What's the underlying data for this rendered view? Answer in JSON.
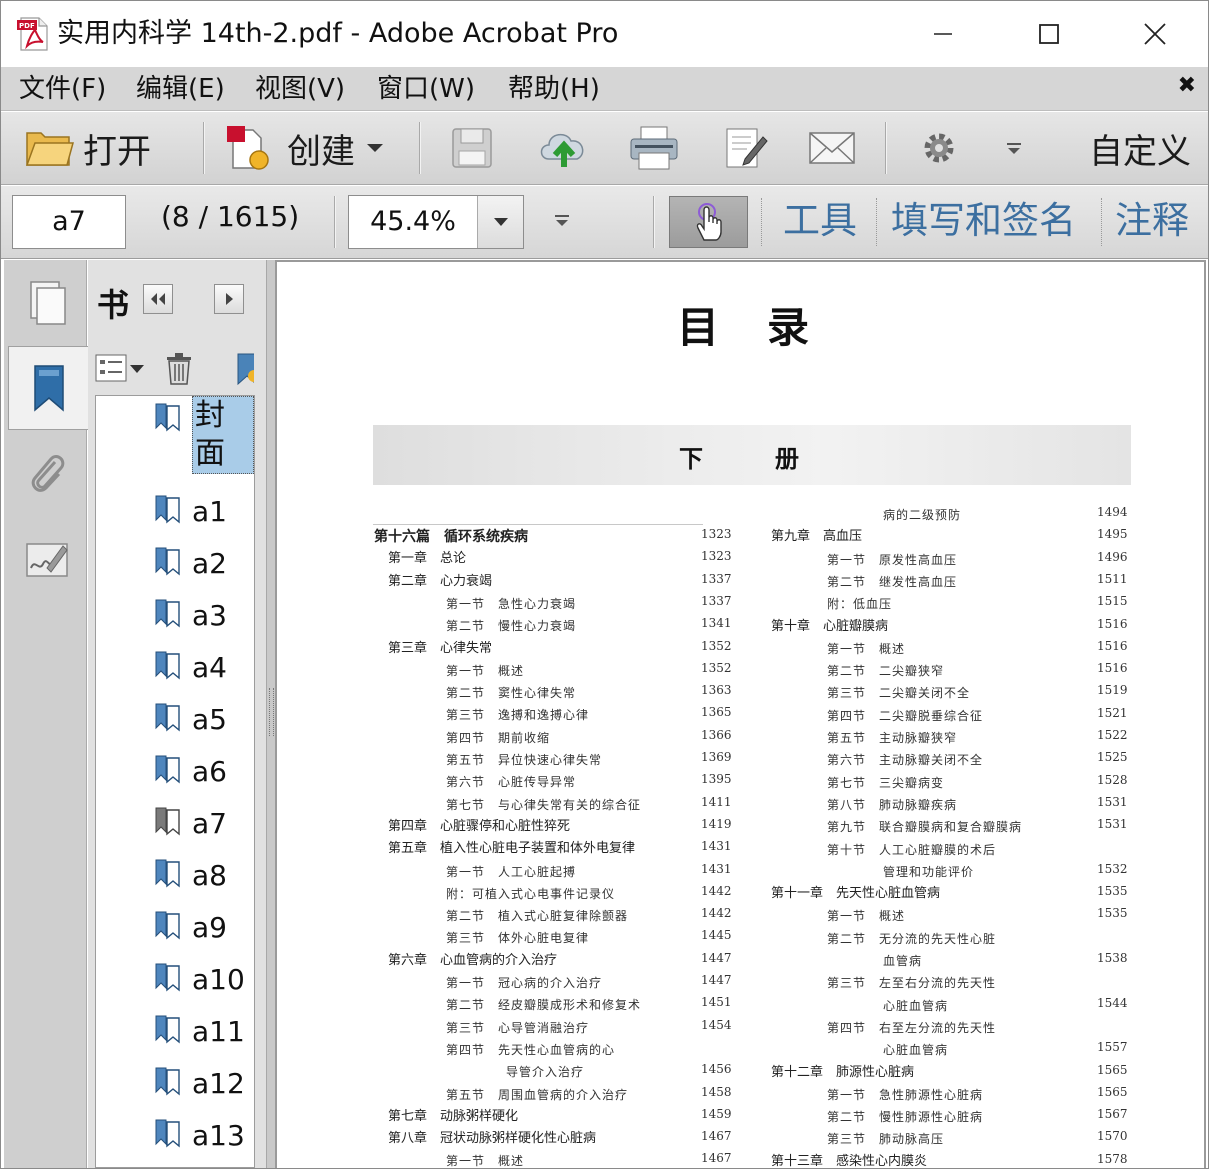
{
  "window": {
    "title": "实用内科学 14th-2.pdf - Adobe Acrobat Pro"
  },
  "menu": [
    {
      "label": "文件(F)"
    },
    {
      "label": "编辑(E)"
    },
    {
      "label": "视图(V)"
    },
    {
      "label": "窗口(W)"
    },
    {
      "label": "帮助(H)"
    }
  ],
  "toolbar": {
    "open_label": "打开",
    "create_label": "创建",
    "customize_label": "自定义"
  },
  "nav": {
    "page_value": "a7",
    "page_count": "(8 / 1615)",
    "zoom": "45.4%",
    "tools_label": "工具",
    "fill_sign_label": "填写和签名",
    "comment_label": "注释"
  },
  "bookmarks": {
    "title": "书",
    "items": [
      {
        "label": "封面",
        "selected": true
      },
      {
        "label": "a1"
      },
      {
        "label": "a2"
      },
      {
        "label": "a3"
      },
      {
        "label": "a4"
      },
      {
        "label": "a5"
      },
      {
        "label": "a6"
      },
      {
        "label": "a7",
        "current": true
      },
      {
        "label": "a8"
      },
      {
        "label": "a9"
      },
      {
        "label": "a10"
      },
      {
        "label": "a11"
      },
      {
        "label": "a12"
      },
      {
        "label": "a13"
      }
    ]
  },
  "document": {
    "heading": "目录",
    "banner": "下册",
    "left_col": [
      {
        "text": "第十六篇　循环系统疾病",
        "page": "1323",
        "level": "part"
      },
      {
        "text": "第一章　总论",
        "page": "1323",
        "level": "ch"
      },
      {
        "text": "第二章　心力衰竭",
        "page": "1337",
        "level": "ch"
      },
      {
        "text": "第一节　急性心力衰竭",
        "page": "1337",
        "level": "sec"
      },
      {
        "text": "第二节　慢性心力衰竭",
        "page": "1341",
        "level": "sec"
      },
      {
        "text": "第三章　心律失常",
        "page": "1352",
        "level": "ch"
      },
      {
        "text": "第一节　概述",
        "page": "1352",
        "level": "sec"
      },
      {
        "text": "第二节　窦性心律失常",
        "page": "1363",
        "level": "sec"
      },
      {
        "text": "第三节　逸搏和逸搏心律",
        "page": "1365",
        "level": "sec"
      },
      {
        "text": "第四节　期前收缩",
        "page": "1366",
        "level": "sec"
      },
      {
        "text": "第五节　异位快速心律失常",
        "page": "1369",
        "level": "sec"
      },
      {
        "text": "第六节　心脏传导异常",
        "page": "1395",
        "level": "sec"
      },
      {
        "text": "第七节　与心律失常有关的综合征",
        "page": "1411",
        "level": "sec"
      },
      {
        "text": "第四章　心脏骤停和心脏性猝死",
        "page": "1419",
        "level": "ch"
      },
      {
        "text": "第五章　植入性心脏电子装置和体外电复律",
        "page": "1431",
        "level": "ch"
      },
      {
        "text": "第一节　人工心脏起搏",
        "page": "1431",
        "level": "sec"
      },
      {
        "text": "附：可植入式心电事件记录仪",
        "page": "1442",
        "level": "sec"
      },
      {
        "text": "第二节　植入式心脏复律除颤器",
        "page": "1442",
        "level": "sec"
      },
      {
        "text": "第三节　体外心脏电复律",
        "page": "1445",
        "level": "sec"
      },
      {
        "text": "第六章　心血管病的介入治疗",
        "page": "1447",
        "level": "ch"
      },
      {
        "text": "第一节　冠心病的介入治疗",
        "page": "1447",
        "level": "sec"
      },
      {
        "text": "第二节　经皮瓣膜成形术和修复术",
        "page": "1451",
        "level": "sec"
      },
      {
        "text": "第三节　心导管消融治疗",
        "page": "1454",
        "level": "sec"
      },
      {
        "text": "第四节　先天性心血管病的心",
        "page": "",
        "level": "sec"
      },
      {
        "text": "导管介入治疗",
        "page": "1456",
        "level": "sec2"
      },
      {
        "text": "第五节　周围血管病的介入治疗",
        "page": "1458",
        "level": "sec"
      },
      {
        "text": "第七章　动脉粥样硬化",
        "page": "1459",
        "level": "ch"
      },
      {
        "text": "第八章　冠状动脉粥样硬化性心脏病",
        "page": "1467",
        "level": "ch"
      },
      {
        "text": "第一节　概述",
        "page": "1467",
        "level": "sec"
      }
    ],
    "right_col": [
      {
        "text": "病的二级预防",
        "page": "1494",
        "level": "sec2"
      },
      {
        "text": "第九章　高血压",
        "page": "1495",
        "level": "ch"
      },
      {
        "text": "第一节　原发性高血压",
        "page": "1496",
        "level": "sec"
      },
      {
        "text": "第二节　继发性高血压",
        "page": "1511",
        "level": "sec"
      },
      {
        "text": "附：低血压",
        "page": "1515",
        "level": "sec"
      },
      {
        "text": "第十章　心脏瓣膜病",
        "page": "1516",
        "level": "ch"
      },
      {
        "text": "第一节　概述",
        "page": "1516",
        "level": "sec"
      },
      {
        "text": "第二节　二尖瓣狭窄",
        "page": "1516",
        "level": "sec"
      },
      {
        "text": "第三节　二尖瓣关闭不全",
        "page": "1519",
        "level": "sec"
      },
      {
        "text": "第四节　二尖瓣脱垂综合征",
        "page": "1521",
        "level": "sec"
      },
      {
        "text": "第五节　主动脉瓣狭窄",
        "page": "1522",
        "level": "sec"
      },
      {
        "text": "第六节　主动脉瓣关闭不全",
        "page": "1525",
        "level": "sec"
      },
      {
        "text": "第七节　三尖瓣病变",
        "page": "1528",
        "level": "sec"
      },
      {
        "text": "第八节　肺动脉瓣疾病",
        "page": "1531",
        "level": "sec"
      },
      {
        "text": "第九节　联合瓣膜病和复合瓣膜病",
        "page": "1531",
        "level": "sec"
      },
      {
        "text": "第十节　人工心脏瓣膜的术后",
        "page": "",
        "level": "sec"
      },
      {
        "text": "管理和功能评价",
        "page": "1532",
        "level": "sec2"
      },
      {
        "text": "第十一章　先天性心脏血管病",
        "page": "1535",
        "level": "ch"
      },
      {
        "text": "第一节　概述",
        "page": "1535",
        "level": "sec"
      },
      {
        "text": "第二节　无分流的先天性心脏",
        "page": "",
        "level": "sec"
      },
      {
        "text": "血管病",
        "page": "1538",
        "level": "sec2"
      },
      {
        "text": "第三节　左至右分流的先天性",
        "page": "",
        "level": "sec"
      },
      {
        "text": "心脏血管病",
        "page": "1544",
        "level": "sec2"
      },
      {
        "text": "第四节　右至左分流的先天性",
        "page": "",
        "level": "sec"
      },
      {
        "text": "心脏血管病",
        "page": "1557",
        "level": "sec2"
      },
      {
        "text": "第十二章　肺源性心脏病",
        "page": "1565",
        "level": "ch"
      },
      {
        "text": "第一节　急性肺源性心脏病",
        "page": "1565",
        "level": "sec"
      },
      {
        "text": "第二节　慢性肺源性心脏病",
        "page": "1567",
        "level": "sec"
      },
      {
        "text": "第三节　肺动脉高压",
        "page": "1570",
        "level": "sec"
      },
      {
        "text": "第十三章　感染性心内膜炎",
        "page": "1578",
        "level": "ch"
      }
    ]
  }
}
